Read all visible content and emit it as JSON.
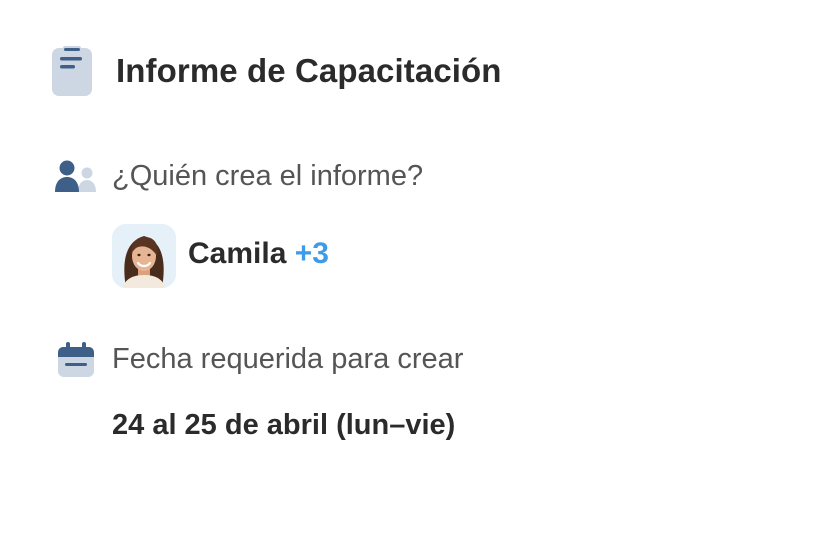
{
  "report": {
    "title": "Informe de Capacitación",
    "title_icon": "clipboard-icon"
  },
  "creator_section": {
    "label": "¿Quién crea el informe?",
    "icon": "people-icon",
    "creator_name": "Camila",
    "extra_count": "+3"
  },
  "date_section": {
    "label": "Fecha requerida para crear",
    "icon": "calendar-icon",
    "value": "24 al 25 de abril (lun–vie)"
  },
  "colors": {
    "icon_primary": "#3e5f88",
    "icon_secondary": "#cdd6e3",
    "accent": "#3d9be9",
    "text_dark": "#2b2b2b",
    "text_muted": "#555555"
  }
}
